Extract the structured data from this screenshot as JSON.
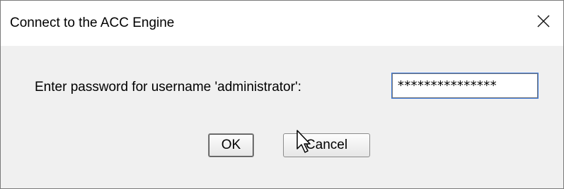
{
  "window": {
    "title": "Connect to the ACC Engine"
  },
  "form": {
    "prompt": "Enter password for username 'administrator':",
    "password_value": "***************"
  },
  "buttons": {
    "ok_label": "OK",
    "cancel_label": "Cancel"
  },
  "icons": {
    "close": "close-icon",
    "cursor": "mouse-pointer-icon"
  },
  "colors": {
    "titlebar": "#ffffff",
    "body": "#f0f0f0",
    "focus": "#3b78d8"
  }
}
